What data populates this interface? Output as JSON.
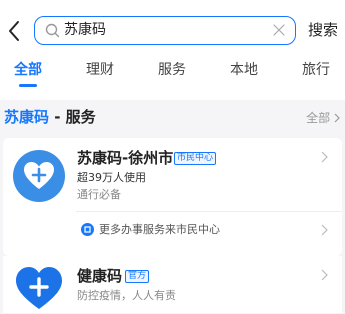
{
  "header": {
    "search_query": "苏康码",
    "search_button": "搜索"
  },
  "tabs": [
    {
      "label": "全部",
      "active": true
    },
    {
      "label": "理财",
      "active": false
    },
    {
      "label": "服务",
      "active": false
    },
    {
      "label": "本地",
      "active": false
    },
    {
      "label": "旅行",
      "active": false
    }
  ],
  "section": {
    "title_highlight": "苏康码",
    "title_rest": " - 服务",
    "more_label": "全部"
  },
  "results": [
    {
      "name": "苏康码-徐州市",
      "badge": "市民中心",
      "stats": "超39万人使用",
      "tag": "通行必备",
      "more_link": "更多办事服务来市民中心",
      "icon": "heart-plus-icon",
      "icon_color": "#3a8ee6"
    },
    {
      "name": "健康码",
      "badge": "官方",
      "desc": "防控疫情，人人有责",
      "icon": "heart-plus-icon",
      "icon_color": "#1c73e8"
    }
  ],
  "colors": {
    "accent": "#1677ff",
    "background": "#f5f5f7"
  }
}
